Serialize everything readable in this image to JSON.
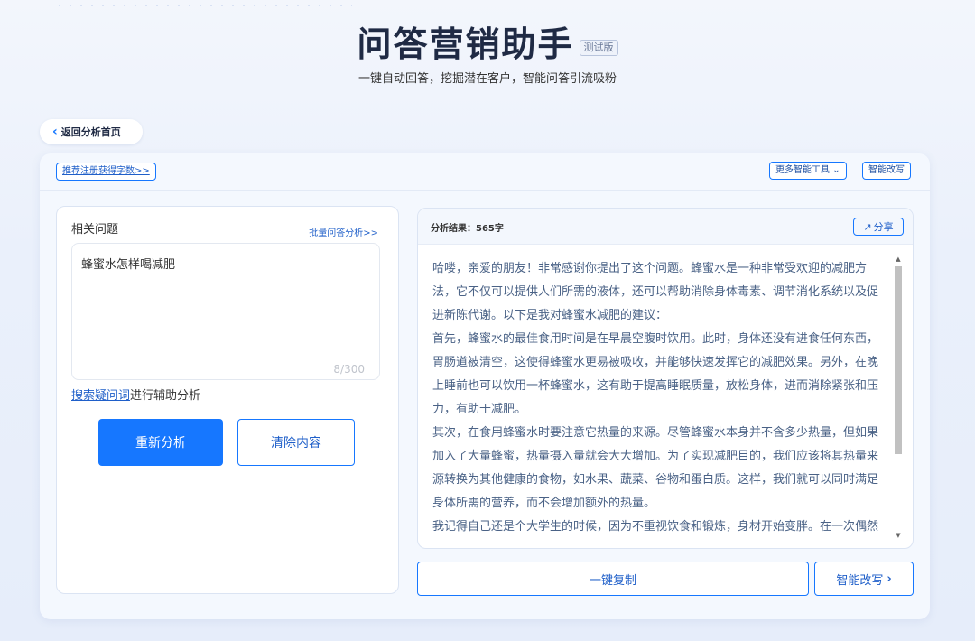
{
  "header": {
    "title": "问答营销助手",
    "badge": "测试版",
    "subtitle": "一键自动回答，挖掘潜在客户，智能问答引流吸粉"
  },
  "nav": {
    "back_label": "返回分析首页"
  },
  "toolbar": {
    "register_label": "推荐注册获得字数>>",
    "more_tools_label": "更多智能工具",
    "smart_rewrite_label": "智能改写"
  },
  "question_panel": {
    "label": "相关问题",
    "batch_link": "批量问答分析>>",
    "input_value": "蜂蜜水怎样喝减肥",
    "char_count": "8/300",
    "assist_link": "搜索疑问词",
    "assist_suffix": "进行辅助分析",
    "reanalyze_label": "重新分析",
    "clear_label": "清除内容"
  },
  "result_panel": {
    "result_label": "分析结果：565字",
    "share_label": "分享",
    "paragraphs": [
      "哈喽，亲爱的朋友！非常感谢你提出了这个问题。蜂蜜水是一种非常受欢迎的减肥方法，它不仅可以提供人们所需的液体，还可以帮助消除身体毒素、调节消化系统以及促进新陈代谢。以下是我对蜂蜜水减肥的建议：",
      "首先，蜂蜜水的最佳食用时间是在早晨空腹时饮用。此时，身体还没有进食任何东西，胃肠道被清空，这使得蜂蜜水更易被吸收，并能够快速发挥它的减肥效果。另外，在晚上睡前也可以饮用一杯蜂蜜水，这有助于提高睡眠质量，放松身体，进而消除紧张和压力，有助于减肥。",
      "其次，在食用蜂蜜水时要注意它热量的来源。尽管蜂蜜水本身并不含多少热量，但如果加入了大量蜂蜜，热量摄入量就会大大增加。为了实现减肥目的，我们应该将其热量来源转换为其他健康的食物，如水果、蔬菜、谷物和蛋白质。这样，我们就可以同时满足身体所需的营养，而不会增加额外的热量。",
      "我记得自己还是个大学生的时候，因为不重视饮食和锻炼，身材开始变胖。在一次偶然的机会中，我了解到了蜂蜜水减肥方法。此后，我坚持每天早晨饮用蜂蜜水，并"
    ],
    "copy_label": "一键复制",
    "smart_rewrite_label": "智能改写"
  }
}
